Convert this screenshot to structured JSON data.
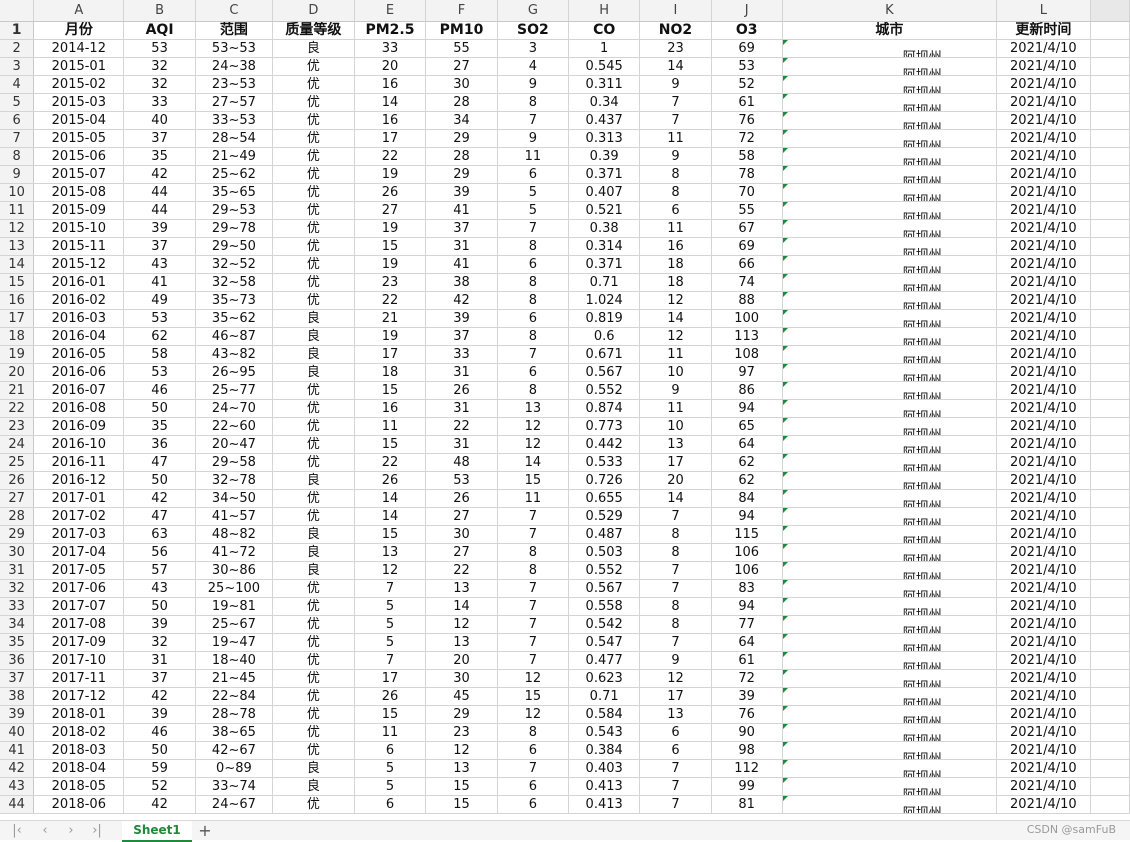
{
  "columns": [
    "A",
    "B",
    "C",
    "D",
    "E",
    "F",
    "G",
    "H",
    "I",
    "J",
    "K",
    "L"
  ],
  "headers": [
    "月份",
    "AQI",
    "范围",
    "质量等级",
    "PM2.5",
    "PM10",
    "SO2",
    "CO",
    "NO2",
    "O3",
    "城市",
    "更新时间"
  ],
  "rows": [
    [
      "2014-12",
      "53",
      "53~53",
      "良",
      "33",
      "55",
      "3",
      "1",
      "23",
      "69",
      "阿坝州",
      "2021/4/10"
    ],
    [
      "2015-01",
      "32",
      "24~38",
      "优",
      "20",
      "27",
      "4",
      "0.545",
      "14",
      "53",
      "阿坝州",
      "2021/4/10"
    ],
    [
      "2015-02",
      "32",
      "23~53",
      "优",
      "16",
      "30",
      "9",
      "0.311",
      "9",
      "52",
      "阿坝州",
      "2021/4/10"
    ],
    [
      "2015-03",
      "33",
      "27~57",
      "优",
      "14",
      "28",
      "8",
      "0.34",
      "7",
      "61",
      "阿坝州",
      "2021/4/10"
    ],
    [
      "2015-04",
      "40",
      "33~53",
      "优",
      "16",
      "34",
      "7",
      "0.437",
      "7",
      "76",
      "阿坝州",
      "2021/4/10"
    ],
    [
      "2015-05",
      "37",
      "28~54",
      "优",
      "17",
      "29",
      "9",
      "0.313",
      "11",
      "72",
      "阿坝州",
      "2021/4/10"
    ],
    [
      "2015-06",
      "35",
      "21~49",
      "优",
      "22",
      "28",
      "11",
      "0.39",
      "9",
      "58",
      "阿坝州",
      "2021/4/10"
    ],
    [
      "2015-07",
      "42",
      "25~62",
      "优",
      "19",
      "29",
      "6",
      "0.371",
      "8",
      "78",
      "阿坝州",
      "2021/4/10"
    ],
    [
      "2015-08",
      "44",
      "35~65",
      "优",
      "26",
      "39",
      "5",
      "0.407",
      "8",
      "70",
      "阿坝州",
      "2021/4/10"
    ],
    [
      "2015-09",
      "44",
      "29~53",
      "优",
      "27",
      "41",
      "5",
      "0.521",
      "6",
      "55",
      "阿坝州",
      "2021/4/10"
    ],
    [
      "2015-10",
      "39",
      "29~78",
      "优",
      "19",
      "37",
      "7",
      "0.38",
      "11",
      "67",
      "阿坝州",
      "2021/4/10"
    ],
    [
      "2015-11",
      "37",
      "29~50",
      "优",
      "15",
      "31",
      "8",
      "0.314",
      "16",
      "69",
      "阿坝州",
      "2021/4/10"
    ],
    [
      "2015-12",
      "43",
      "32~52",
      "优",
      "19",
      "41",
      "6",
      "0.371",
      "18",
      "66",
      "阿坝州",
      "2021/4/10"
    ],
    [
      "2016-01",
      "41",
      "32~58",
      "优",
      "23",
      "38",
      "8",
      "0.71",
      "18",
      "74",
      "阿坝州",
      "2021/4/10"
    ],
    [
      "2016-02",
      "49",
      "35~73",
      "优",
      "22",
      "42",
      "8",
      "1.024",
      "12",
      "88",
      "阿坝州",
      "2021/4/10"
    ],
    [
      "2016-03",
      "53",
      "35~62",
      "良",
      "21",
      "39",
      "6",
      "0.819",
      "14",
      "100",
      "阿坝州",
      "2021/4/10"
    ],
    [
      "2016-04",
      "62",
      "46~87",
      "良",
      "19",
      "37",
      "8",
      "0.6",
      "12",
      "113",
      "阿坝州",
      "2021/4/10"
    ],
    [
      "2016-05",
      "58",
      "43~82",
      "良",
      "17",
      "33",
      "7",
      "0.671",
      "11",
      "108",
      "阿坝州",
      "2021/4/10"
    ],
    [
      "2016-06",
      "53",
      "26~95",
      "良",
      "18",
      "31",
      "6",
      "0.567",
      "10",
      "97",
      "阿坝州",
      "2021/4/10"
    ],
    [
      "2016-07",
      "46",
      "25~77",
      "优",
      "15",
      "26",
      "8",
      "0.552",
      "9",
      "86",
      "阿坝州",
      "2021/4/10"
    ],
    [
      "2016-08",
      "50",
      "24~70",
      "优",
      "16",
      "31",
      "13",
      "0.874",
      "11",
      "94",
      "阿坝州",
      "2021/4/10"
    ],
    [
      "2016-09",
      "35",
      "22~60",
      "优",
      "11",
      "22",
      "12",
      "0.773",
      "10",
      "65",
      "阿坝州",
      "2021/4/10"
    ],
    [
      "2016-10",
      "36",
      "20~47",
      "优",
      "15",
      "31",
      "12",
      "0.442",
      "13",
      "64",
      "阿坝州",
      "2021/4/10"
    ],
    [
      "2016-11",
      "47",
      "29~58",
      "优",
      "22",
      "48",
      "14",
      "0.533",
      "17",
      "62",
      "阿坝州",
      "2021/4/10"
    ],
    [
      "2016-12",
      "50",
      "32~78",
      "良",
      "26",
      "53",
      "15",
      "0.726",
      "20",
      "62",
      "阿坝州",
      "2021/4/10"
    ],
    [
      "2017-01",
      "42",
      "34~50",
      "优",
      "14",
      "26",
      "11",
      "0.655",
      "14",
      "84",
      "阿坝州",
      "2021/4/10"
    ],
    [
      "2017-02",
      "47",
      "41~57",
      "优",
      "14",
      "27",
      "7",
      "0.529",
      "7",
      "94",
      "阿坝州",
      "2021/4/10"
    ],
    [
      "2017-03",
      "63",
      "48~82",
      "良",
      "15",
      "30",
      "7",
      "0.487",
      "8",
      "115",
      "阿坝州",
      "2021/4/10"
    ],
    [
      "2017-04",
      "56",
      "41~72",
      "良",
      "13",
      "27",
      "8",
      "0.503",
      "8",
      "106",
      "阿坝州",
      "2021/4/10"
    ],
    [
      "2017-05",
      "57",
      "30~86",
      "良",
      "12",
      "22",
      "8",
      "0.552",
      "7",
      "106",
      "阿坝州",
      "2021/4/10"
    ],
    [
      "2017-06",
      "43",
      "25~100",
      "优",
      "7",
      "13",
      "7",
      "0.567",
      "7",
      "83",
      "阿坝州",
      "2021/4/10"
    ],
    [
      "2017-07",
      "50",
      "19~81",
      "优",
      "5",
      "14",
      "7",
      "0.558",
      "8",
      "94",
      "阿坝州",
      "2021/4/10"
    ],
    [
      "2017-08",
      "39",
      "25~67",
      "优",
      "5",
      "12",
      "7",
      "0.542",
      "8",
      "77",
      "阿坝州",
      "2021/4/10"
    ],
    [
      "2017-09",
      "32",
      "19~47",
      "优",
      "5",
      "13",
      "7",
      "0.547",
      "7",
      "64",
      "阿坝州",
      "2021/4/10"
    ],
    [
      "2017-10",
      "31",
      "18~40",
      "优",
      "7",
      "20",
      "7",
      "0.477",
      "9",
      "61",
      "阿坝州",
      "2021/4/10"
    ],
    [
      "2017-11",
      "37",
      "21~45",
      "优",
      "17",
      "30",
      "12",
      "0.623",
      "12",
      "72",
      "阿坝州",
      "2021/4/10"
    ],
    [
      "2017-12",
      "42",
      "22~84",
      "优",
      "26",
      "45",
      "15",
      "0.71",
      "17",
      "39",
      "阿坝州",
      "2021/4/10"
    ],
    [
      "2018-01",
      "39",
      "28~78",
      "优",
      "15",
      "29",
      "12",
      "0.584",
      "13",
      "76",
      "阿坝州",
      "2021/4/10"
    ],
    [
      "2018-02",
      "46",
      "38~65",
      "优",
      "11",
      "23",
      "8",
      "0.543",
      "6",
      "90",
      "阿坝州",
      "2021/4/10"
    ],
    [
      "2018-03",
      "50",
      "42~67",
      "优",
      "6",
      "12",
      "6",
      "0.384",
      "6",
      "98",
      "阿坝州",
      "2021/4/10"
    ],
    [
      "2018-04",
      "59",
      "0~89",
      "良",
      "5",
      "13",
      "7",
      "0.403",
      "7",
      "112",
      "阿坝州",
      "2021/4/10"
    ],
    [
      "2018-05",
      "52",
      "33~74",
      "良",
      "5",
      "15",
      "6",
      "0.413",
      "7",
      "99",
      "阿坝州",
      "2021/4/10"
    ],
    [
      "2018-06",
      "42",
      "24~67",
      "优",
      "6",
      "15",
      "6",
      "0.413",
      "7",
      "81",
      "阿坝州",
      "2021/4/10"
    ]
  ],
  "status_bar": {
    "sheet_tab": "Sheet1",
    "add_sheet": "+",
    "watermark": "CSDN @samFuB"
  },
  "nav_icons": [
    "first-sheet-icon",
    "prev-sheet-icon",
    "next-sheet-icon",
    "last-sheet-icon"
  ]
}
